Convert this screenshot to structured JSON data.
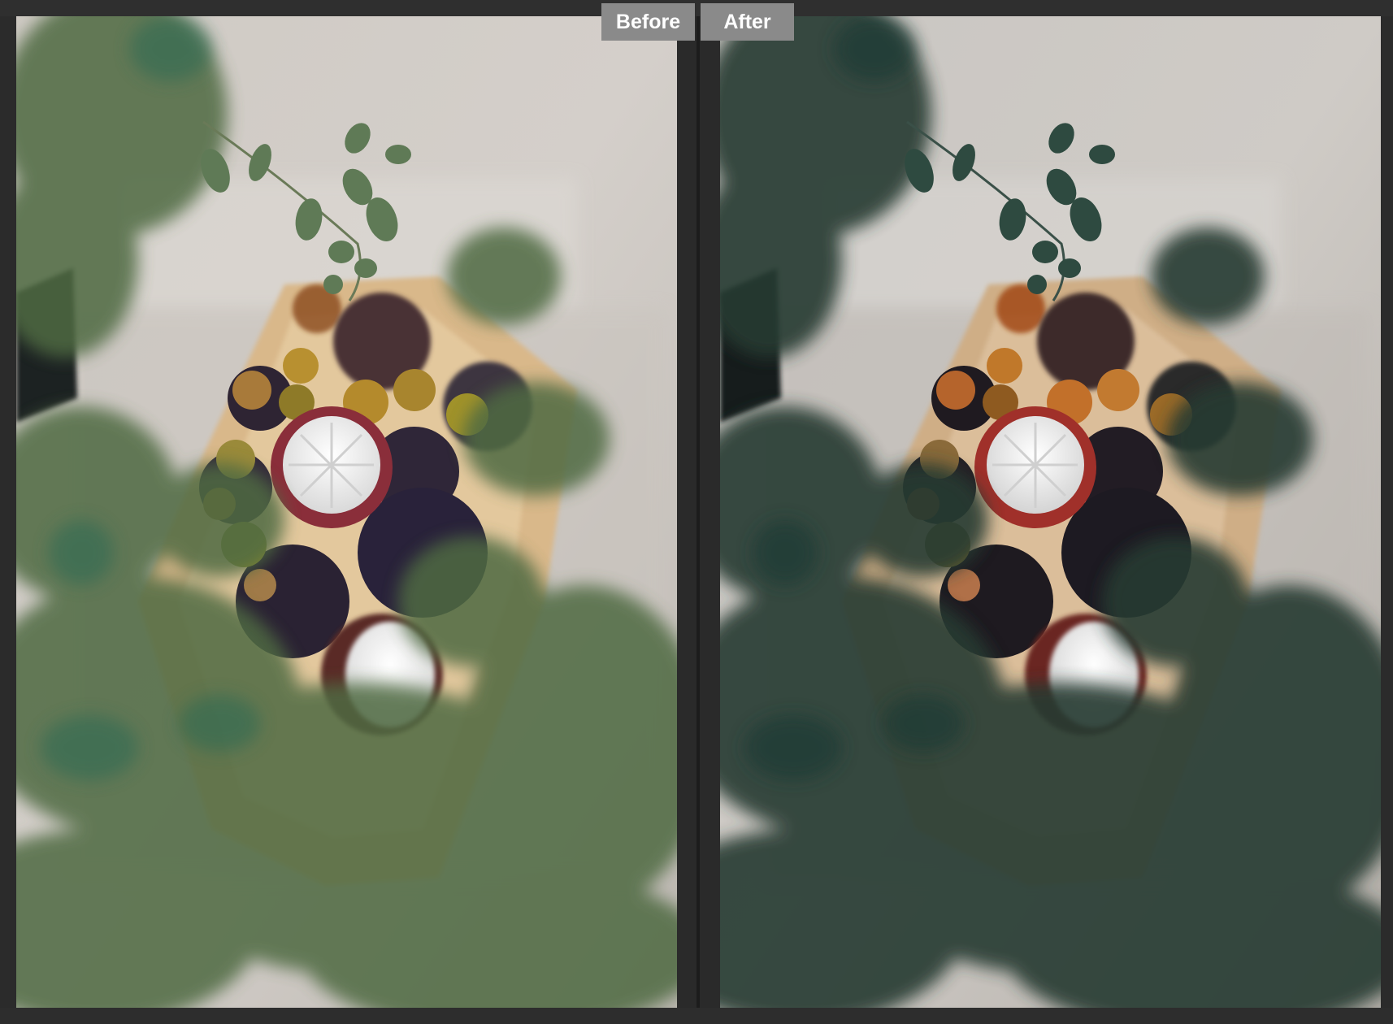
{
  "compare": {
    "before_label": "Before",
    "after_label": "After"
  },
  "colors": {
    "background": "#2b2b2b",
    "label_bg": "#8a8a8a",
    "label_text": "#ffffff"
  },
  "icons": [
    "photo-preview-before",
    "photo-preview-after"
  ]
}
